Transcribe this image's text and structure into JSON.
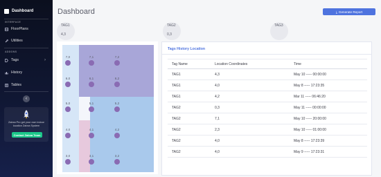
{
  "sidebar": {
    "brand": "Dashboard",
    "section_interface": "INTERFACE",
    "section_addons": "ADDONS",
    "items": [
      {
        "label": "FloorPlans",
        "icon": "floorplan-icon"
      },
      {
        "label": "Utilities",
        "icon": "wrench-icon"
      },
      {
        "label": "Tags",
        "icon": "tag-icon"
      },
      {
        "label": "History",
        "icon": "history-icon"
      },
      {
        "label": "Tables",
        "icon": "table-icon"
      }
    ],
    "collapse_icon": "chevron-left-icon",
    "promo": {
      "text": "Zabxa Pro get your own indoor location Zabxa System",
      "button": "Contact Zabxa Team",
      "icon": "rocket-icon"
    }
  },
  "header": {
    "title": "Dashboard",
    "report_button": "Generate Report",
    "report_icon": "download-icon"
  },
  "tags": [
    {
      "name": "TAG1",
      "value": "4,3"
    },
    {
      "name": "TAG2",
      "value": "0,3"
    },
    {
      "name": "TAG3",
      "value": ""
    }
  ],
  "map": {
    "points": [
      {
        "label": "7,0"
      },
      {
        "label": "7,1"
      },
      {
        "label": "7,2"
      },
      {
        "label": "6,0"
      },
      {
        "label": "6,1"
      },
      {
        "label": "6,2"
      },
      {
        "label": "5,0"
      },
      {
        "label": "5,1"
      },
      {
        "label": "5,2"
      },
      {
        "label": "4,0"
      },
      {
        "label": "4,1"
      },
      {
        "label": "4,2"
      },
      {
        "label": "3,0"
      },
      {
        "label": "3,1"
      },
      {
        "label": "3,2"
      }
    ],
    "colors": {
      "point": "#8a6bb3",
      "region_purple": "#a8a6d8",
      "region_blue": "#a9c9ec",
      "region_lightblue": "#d6e6f7",
      "region_pink": "#e7c9dd"
    }
  },
  "history": {
    "title": "Tags History Location",
    "columns": [
      "Tag Name",
      "Location Coordinates",
      "Time"
    ],
    "rows": [
      [
        "TAG1",
        "4,3",
        "May 10 ----- 00:00:00"
      ],
      [
        "TAG1",
        "4,0",
        "May 8 ----- 17:23:35"
      ],
      [
        "TAG1",
        "4,2",
        "Mar 11 ----- 06:46:20"
      ],
      [
        "TAG2",
        "0,3",
        "May 11 ----- 00:00:00"
      ],
      [
        "TAG2",
        "7,1",
        "May 10 ----- 20:00:00"
      ],
      [
        "TAG2",
        "2,3",
        "May 10 ----- 01:00:00"
      ],
      [
        "TAG2",
        "4,0",
        "May 8 ----- 17:23:39"
      ],
      [
        "TAG2",
        "4,0",
        "May 9 ----- 17:23:31"
      ]
    ]
  }
}
